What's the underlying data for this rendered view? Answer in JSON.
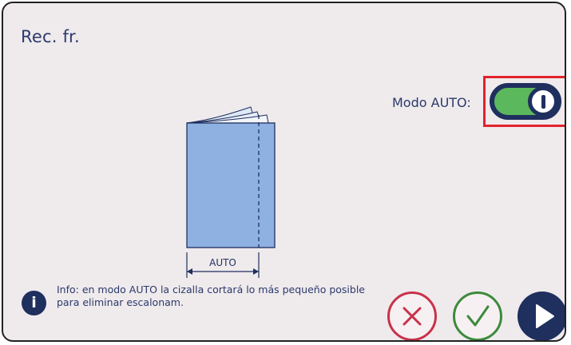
{
  "screen": {
    "title": "Rec. fr."
  },
  "mode": {
    "label": "Modo AUTO:",
    "toggle_on": true
  },
  "diagram": {
    "dimension_label": "AUTO"
  },
  "info": {
    "icon": "info-icon",
    "text": "Info: en modo AUTO la cizalla cortará lo más pequeño posible para eliminar escalonam."
  },
  "actions": {
    "cancel_icon": "x-icon",
    "confirm_icon": "check-icon",
    "next_icon": "play-icon"
  },
  "colors": {
    "accent": "#1f2f5e",
    "toggle_on": "#5cb85c",
    "highlight": "#e3222c",
    "cancel": "#c8324a",
    "confirm": "#3c8a3c",
    "paper": "#8eb1e2"
  }
}
